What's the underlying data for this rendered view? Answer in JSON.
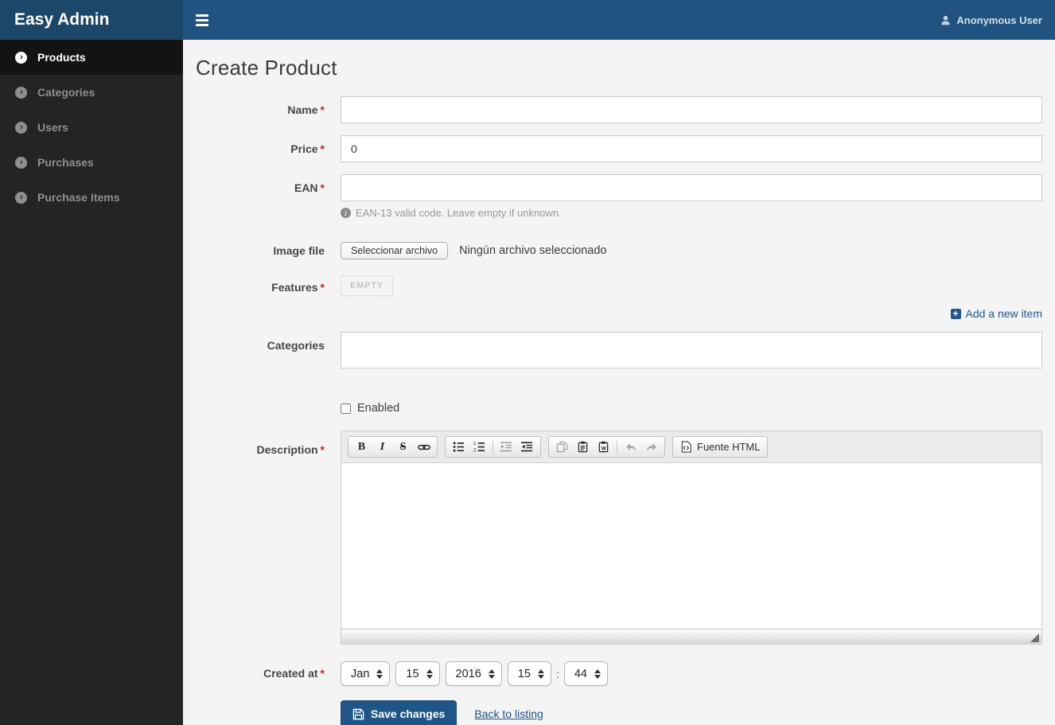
{
  "app": {
    "brand": "Easy Admin",
    "user_label": "Anonymous User"
  },
  "sidebar": {
    "items": [
      {
        "label": "Products",
        "active": true
      },
      {
        "label": "Categories",
        "active": false
      },
      {
        "label": "Users",
        "active": false
      },
      {
        "label": "Purchases",
        "active": false
      },
      {
        "label": "Purchase Items",
        "active": false
      }
    ]
  },
  "page": {
    "title": "Create Product"
  },
  "form": {
    "required_marker": "*",
    "name": {
      "label": "Name",
      "value": ""
    },
    "price": {
      "label": "Price",
      "value": "0"
    },
    "ean": {
      "label": "EAN",
      "value": "",
      "help": "EAN-13 valid code. Leave empty if unknown."
    },
    "image": {
      "label": "Image file",
      "button": "Seleccionar archivo",
      "status": "Ningún archivo seleccionado"
    },
    "features": {
      "label": "Features",
      "empty_badge": "EMPTY",
      "add_link": "Add a new item"
    },
    "categories": {
      "label": "Categories",
      "value": ""
    },
    "enabled": {
      "label": "Enabled",
      "checked": false
    },
    "description": {
      "label": "Description",
      "value": "",
      "source_button": "Fuente HTML"
    },
    "created_at": {
      "label": "Created at",
      "month": "Jan",
      "day": "15",
      "year": "2016",
      "hour": "15",
      "separator": ":",
      "minute": "44"
    },
    "actions": {
      "save": "Save changes",
      "back": "Back to listing"
    }
  },
  "icons": {
    "menu": "hamburger-icon",
    "user": "user-icon",
    "sidebar_item": "chevron-circle-right-icon",
    "help": "info-circle-icon",
    "add": "plus-square-icon",
    "toolbar": [
      "bold-icon",
      "italic-icon",
      "strikethrough-icon",
      "link-icon",
      "bulleted-list-icon",
      "numbered-list-icon",
      "outdent-icon",
      "indent-icon",
      "copy-icon",
      "paste-icon",
      "paste-from-word-icon",
      "undo-icon",
      "redo-icon",
      "html-source-icon"
    ],
    "save": "floppy-disk-icon",
    "resize": "resize-handle-icon"
  },
  "colors": {
    "brand_bg": "#1d4768",
    "topbar_bg": "#215380",
    "sidebar_bg": "#242424",
    "sidebar_active_bg": "#131313",
    "accent": "#20578c",
    "button_bg": "#1f5687",
    "required": "#cc2222",
    "content_bg": "#f4f4f5"
  }
}
